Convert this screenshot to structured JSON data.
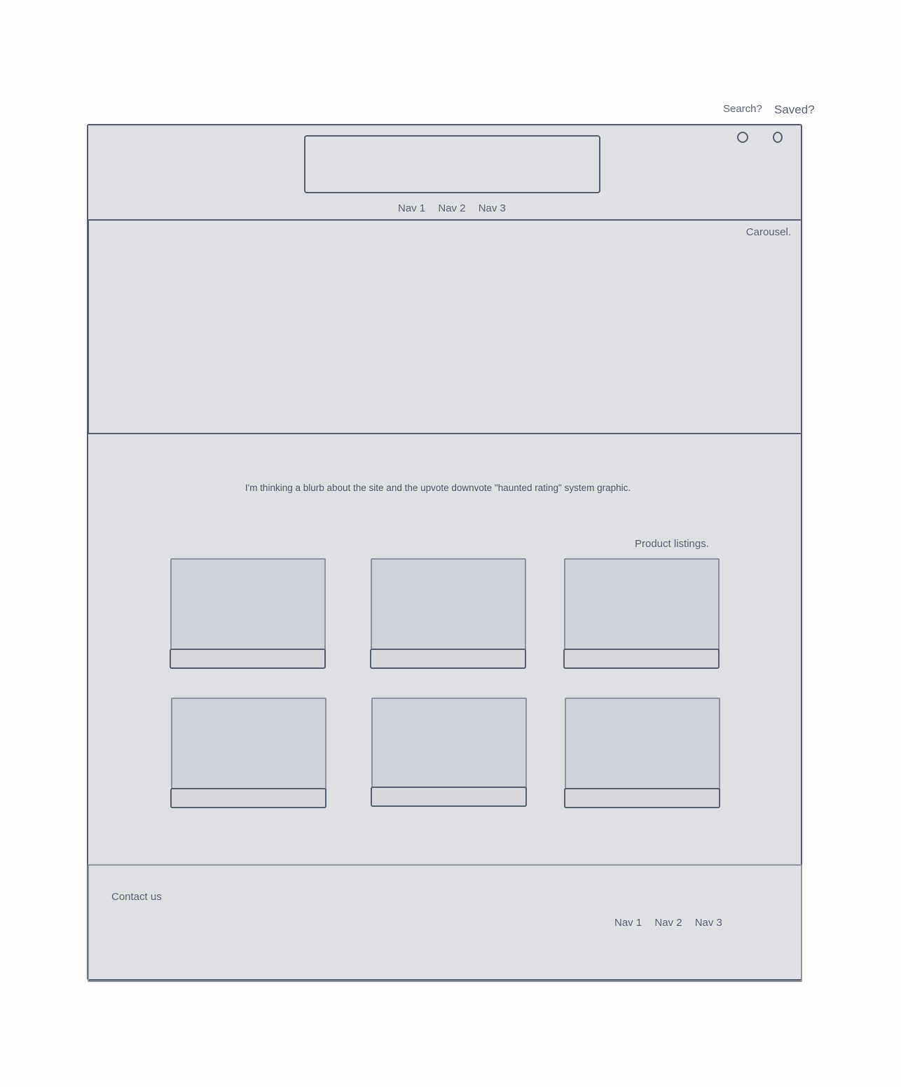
{
  "top_links": {
    "search": "Search?",
    "saved": "Saved?"
  },
  "header": {
    "icons": [
      "search-icon",
      "saved-icon"
    ],
    "nav": [
      "Nav 1",
      "Nav 2",
      "Nav 3"
    ]
  },
  "carousel": {
    "label": "Carousel."
  },
  "blurb": "I'm thinking a blurb about the site and the upvote downvote \"haunted rating\" system graphic.",
  "listings": {
    "label": "Product listings.",
    "count": 6
  },
  "footer": {
    "contact": "Contact us",
    "nav": [
      "Nav 1",
      "Nav 2",
      "Nav 3"
    ]
  }
}
